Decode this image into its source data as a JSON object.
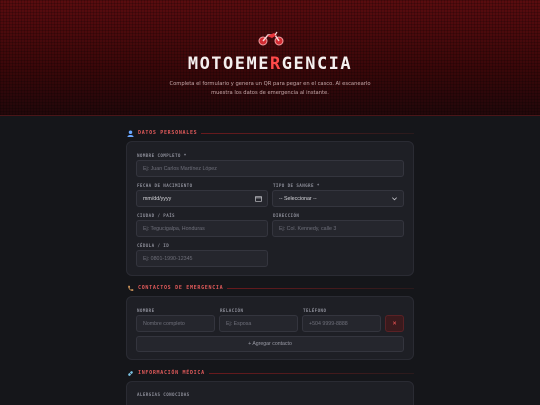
{
  "header": {
    "title_part1": "MOTOEME",
    "title_accent": "R",
    "title_part2": "GENCIA",
    "subtitle": "Completa el formulario y genera un QR para pegar en el casco. Al escanearlo muestra los datos de emergencia al instante."
  },
  "sections": {
    "personal": {
      "title": "DATOS PERSONALES",
      "full_name": {
        "label": "NOMBRE COMPLETO *",
        "placeholder": "Ej: Juan Carlos Martínez López"
      },
      "birth_date": {
        "label": "FECHA DE NACIMIENTO",
        "value": "mm/dd/yyyy"
      },
      "blood_type": {
        "label": "TIPO DE SANGRE *",
        "value": "-- Seleccionar --"
      },
      "city": {
        "label": "CIUDAD / PAÍS",
        "placeholder": "Ej: Tegucigalpa, Honduras"
      },
      "address": {
        "label": "DIRECCIÓN",
        "placeholder": "Ej: Col. Kennedy, calle 3"
      },
      "id_number": {
        "label": "CÉDULA / ID",
        "placeholder": "Ej: 0801-1990-12345"
      }
    },
    "contacts": {
      "title": "CONTACTOS DE EMERGENCIA",
      "name": {
        "label": "NOMBRE",
        "placeholder": "Nombre completo"
      },
      "relation": {
        "label": "RELACIÓN",
        "placeholder": "Ej: Esposa"
      },
      "phone": {
        "label": "TELÉFONO",
        "placeholder": "+504 9999-8888"
      },
      "delete_label": "✕",
      "add_label": "+ Agregar contacto"
    },
    "medical": {
      "title": "INFORMACIÓN MÉDICA",
      "allergies": {
        "label": "ALERGIAS CONOCIDAS"
      }
    }
  },
  "icons": {
    "header": "motorcycle-icon",
    "personal": "person-icon",
    "contacts": "phone-icon",
    "medical": "pill-icon"
  },
  "colors": {
    "accent": "#ff4a4a",
    "section_title": "#e05a5a",
    "background": "#15161a",
    "card": "#1e1f25",
    "header_red": "#5a0c0f"
  }
}
